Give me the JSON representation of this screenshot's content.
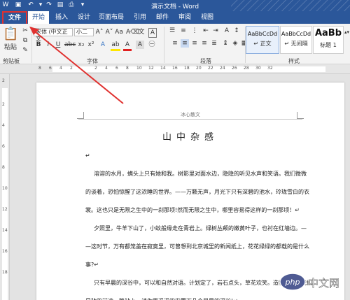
{
  "window": {
    "title": "演示文档 - Word"
  },
  "tabs": [
    "文件",
    "开始",
    "插入",
    "设计",
    "页面布局",
    "引用",
    "邮件",
    "审阅",
    "视图"
  ],
  "ribbon": {
    "paste_label": "粘贴",
    "font_name": "宋体 (中文正文",
    "font_size": "小二",
    "groups": {
      "clipboard": "剪贴板",
      "font": "字体",
      "paragraph": "段落",
      "styles": "样式"
    },
    "styles": [
      {
        "sample": "AaBbCcDd",
        "name": "↵ 正文"
      },
      {
        "sample": "AaBbCcDd",
        "name": "↵ 无间隔"
      },
      {
        "sample": "AaBb",
        "name": "标题 1"
      }
    ]
  },
  "ruler": {
    "h_numbers": [
      "8",
      "6",
      "4",
      "2",
      "2",
      "4",
      "6",
      "8",
      "10",
      "12",
      "14",
      "16",
      "18",
      "20",
      "22",
      "24",
      "26",
      "28",
      "30",
      "32"
    ],
    "v_numbers": [
      "2",
      "2",
      "4",
      "6",
      "8",
      "10",
      "12",
      "14",
      "16",
      "18"
    ]
  },
  "document": {
    "header": "冰心散文",
    "title": "山中杂感",
    "lines": [
      "↵",
      "溶溶的水月，螨头上只有她和我。树影里对面水边，隐隐的听见水声和笑语。我们微微",
      "的谈着，恐怕惊醒了这浓睡的世界。——万籁无声，月光下只有深碧的池水，玲珑雪白的衣",
      "裳。这也只是无限之生中的一刹那顷!然而无限之生中，哪里容易得这样的一刹那顷！↵",
      "夕照里，牛羊下山了，小蚊般缘走在青岩上。绿树丛颠的嫩黄叶子，也衬在红墙边。—",
      "—这时节，万有都笼盖在寂寞里，可曾想到北京城里的新闻纸上，花花绿绿的都载的是什么",
      "事?↵",
      "只有早晨的深谷中，可以和自然对语。计划定了，岩石点头，草花欢笑。造物者呵！我们",
      "星驰的前途，路站上，请你再遥遥的安置下几个早晨的深谷!↵"
    ]
  },
  "watermark": {
    "text": "php 中文网"
  }
}
